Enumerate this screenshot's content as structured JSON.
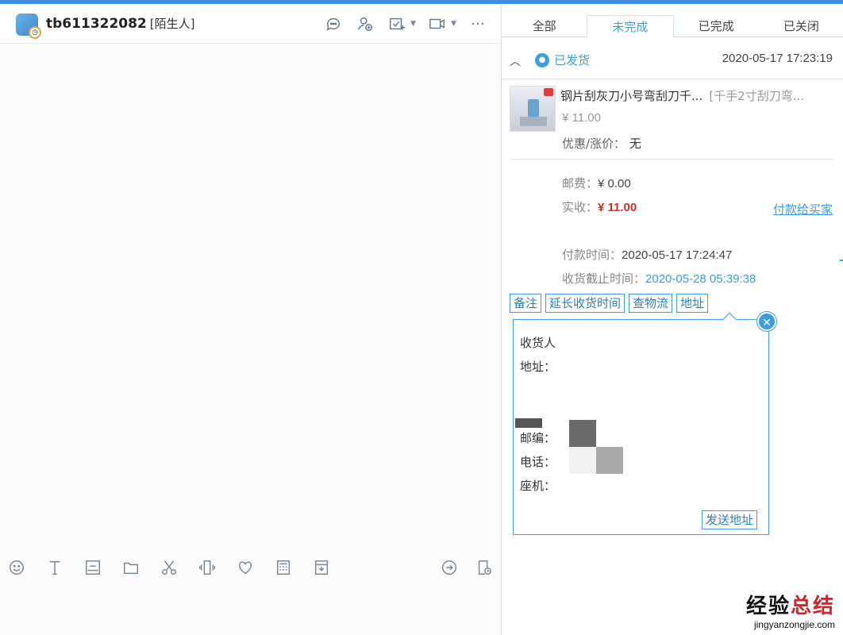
{
  "chat": {
    "username": "tb611322082",
    "user_tag": "[陌生人]"
  },
  "orders": {
    "tabs": [
      "全部",
      "未完成",
      "已完成",
      "已关闭"
    ],
    "active_tab": "未完成",
    "status": "已发货",
    "status_time": "2020-05-17 17:23:19",
    "product_title": "钢片刮灰刀小号弯刮刀千...",
    "product_sku": "[千手2寸刮刀弯...",
    "product_price": "¥ 11.00",
    "discount_label": "优惠/涨价：",
    "discount_value": "无",
    "shipping_label": "邮费：",
    "shipping_value": "¥ 0.00",
    "actual_label": "实收：",
    "actual_value": "¥ 11.00",
    "pay_link": "付款给买家",
    "pay_time_label": "付款时间：",
    "pay_time_value": "2020-05-17 17:24:47",
    "receive_deadline_label": "收货截止时间：",
    "receive_deadline_value": "2020-05-28 05:39:38",
    "buttons": [
      "备注",
      "延长收货时间",
      "查物流",
      "地址"
    ]
  },
  "address": {
    "receiver_label": "收货人",
    "address_label": "地址：",
    "zip_label": "邮编：",
    "phone_label": "电话：",
    "landline_label": "座机：",
    "send_button": "发送地址"
  },
  "watermark": {
    "line1_a": "经验",
    "line1_b": "总结",
    "line2": "jingyanzongjie.com"
  },
  "colors": {
    "accent": "#3a9ee0",
    "price_red": "#c8302a"
  }
}
